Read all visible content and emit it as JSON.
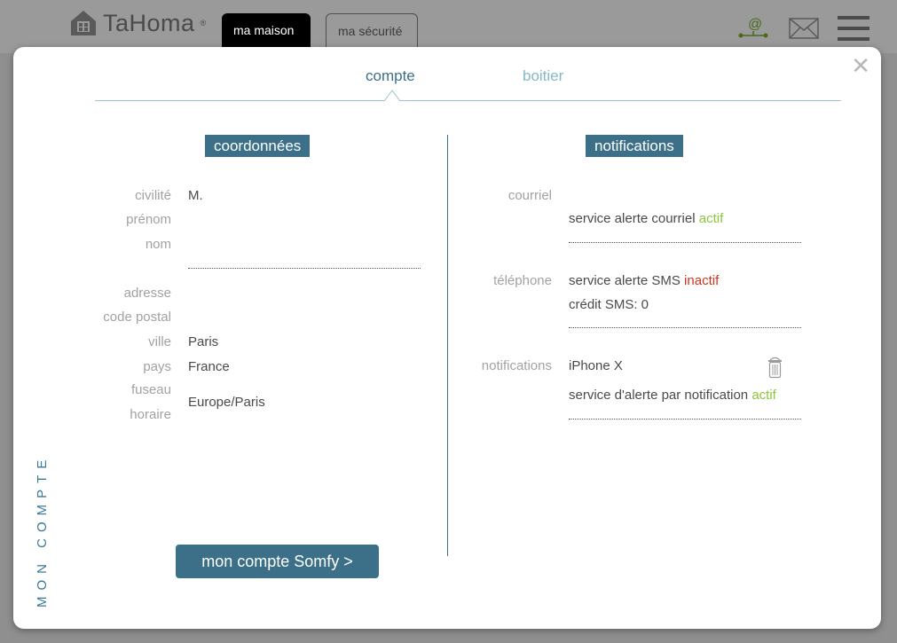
{
  "header": {
    "logo_text": "TaHoma",
    "logo_reg": "®",
    "tabs": [
      {
        "label": "ma maison"
      },
      {
        "label": "ma sécurité"
      }
    ],
    "icons": [
      "at-network-icon",
      "mail-icon",
      "menu-icon"
    ]
  },
  "modal": {
    "close_symbol": "✕",
    "side_label": "MON COMPTE",
    "tabs": [
      {
        "label": "compte",
        "active": true
      },
      {
        "label": "boitier",
        "active": false
      }
    ],
    "coordonnees": {
      "title": "coordonnées",
      "fields": {
        "civilite": {
          "label": "civilité",
          "value": "M."
        },
        "prenom": {
          "label": "prénom",
          "value": ""
        },
        "nom": {
          "label": "nom",
          "value": ""
        },
        "adresse": {
          "label": "adresse",
          "value": ""
        },
        "code_postal": {
          "label": "code postal",
          "value": ""
        },
        "ville": {
          "label": "ville",
          "value": "Paris"
        },
        "pays": {
          "label": "pays",
          "value": "France"
        },
        "fuseau_horaire": {
          "label_line1": "fuseau",
          "label_line2": "horaire",
          "value": "Europe/Paris"
        }
      }
    },
    "notifications": {
      "title": "notifications",
      "courriel": {
        "label": "courriel",
        "service_text": "service alerte courriel",
        "status": "actif"
      },
      "telephone": {
        "label": "téléphone",
        "service_text": "service alerte SMS",
        "status": "inactif",
        "credit": "crédit SMS: 0"
      },
      "push": {
        "label": "notifications",
        "device": "iPhone X",
        "service_text": "service d'alerte par notification",
        "status": "actif"
      }
    },
    "somfy_button": "mon compte Somfy >"
  },
  "colors": {
    "accent": "#3c7088",
    "active_status": "#8cc63f",
    "inactive_status": "#d0331d",
    "overlay": "#8f8f8f"
  }
}
